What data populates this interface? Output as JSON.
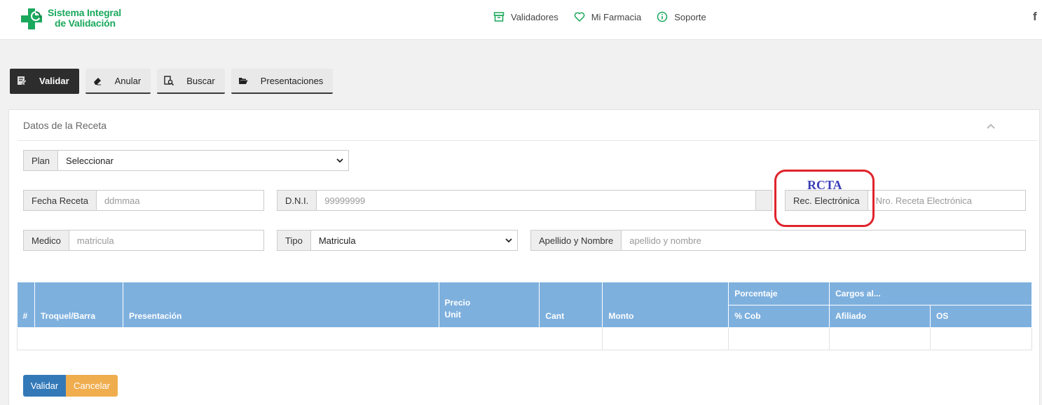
{
  "header": {
    "brand_line1": "Sistema Integral",
    "brand_line2": "de Validación",
    "nav": [
      {
        "label": "Validadores",
        "icon": "archive-icon"
      },
      {
        "label": "Mi Farmacia",
        "icon": "heart-icon"
      },
      {
        "label": "Soporte",
        "icon": "info-icon"
      }
    ],
    "social": "f"
  },
  "toolbar": {
    "buttons": [
      {
        "label": "Validar",
        "icon": "edit-note-icon",
        "active": true
      },
      {
        "label": "Anular",
        "icon": "eraser-icon",
        "active": false
      },
      {
        "label": "Buscar",
        "icon": "search-document-icon",
        "active": false
      },
      {
        "label": "Presentaciones",
        "icon": "folder-open-icon",
        "active": false
      }
    ]
  },
  "panel": {
    "title": "Datos de la Receta",
    "plan": {
      "label": "Plan",
      "value": "Seleccionar"
    },
    "fecha": {
      "label": "Fecha Receta",
      "placeholder": "ddmmaa"
    },
    "dni": {
      "label": "D.N.I.",
      "placeholder": "99999999"
    },
    "rec": {
      "label": "Rec. Electrónica",
      "placeholder": "Nro. Receta Electrónica"
    },
    "medico": {
      "label": "Medico",
      "placeholder": "matricula"
    },
    "tipo": {
      "label": "Tipo",
      "value": "Matricula"
    },
    "apellido": {
      "label": "Apellido y Nombre",
      "placeholder": "apellido y nombre"
    },
    "annotation": "RCTA"
  },
  "table": {
    "headers": {
      "num": "#",
      "troquel": "Troquel/Barra",
      "presentacion": "Presentación",
      "precio": "Precio Unit",
      "cant": "Cant",
      "monto": "Monto",
      "porcentaje": "Porcentaje",
      "cob": "% Cob",
      "cargos": "Cargos al...",
      "afiliado": "Afiliado",
      "os": "OS"
    }
  },
  "actions": {
    "validar": "Validar",
    "cancelar": "Cancelar"
  },
  "colors": {
    "brand": "#1aa85c",
    "table_header": "#7eb0de",
    "primary": "#3379b8",
    "warning": "#f0ad4e",
    "highlight": "#e0242c"
  }
}
